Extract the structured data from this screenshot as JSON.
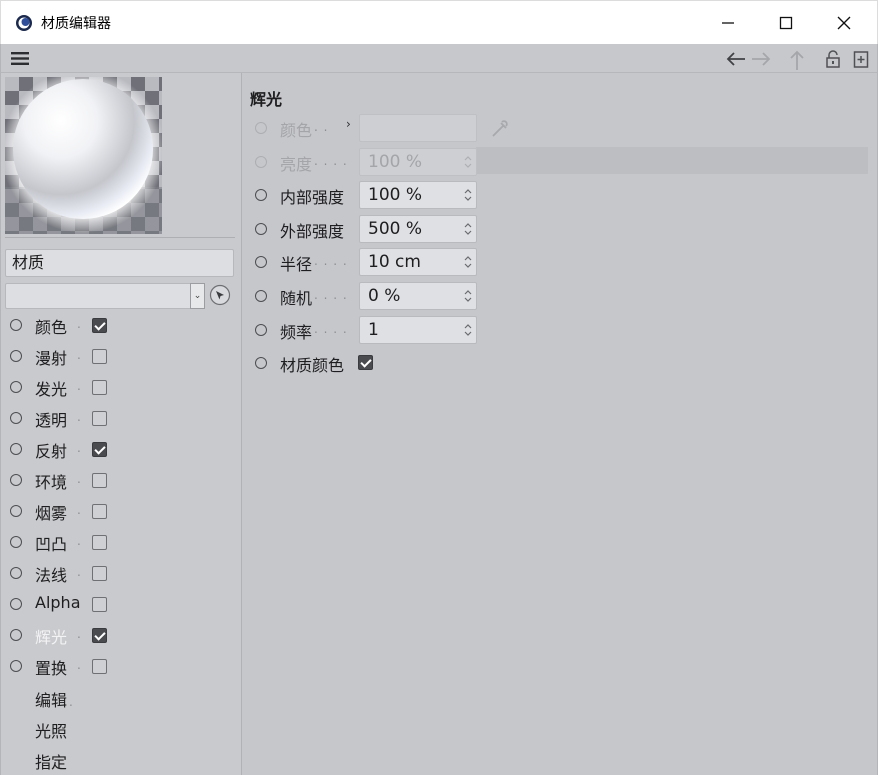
{
  "window": {
    "title": "材质编辑器",
    "app_icon": "cinema4d-logo-icon",
    "controls": [
      "minimize-icon",
      "maximize-icon",
      "close-icon"
    ]
  },
  "toolbar": {
    "menu_icon": "hamburger-menu-icon",
    "nav_icons": [
      "arrow-left-icon",
      "arrow-right-icon",
      "arrow-up-icon",
      "lock-icon",
      "new-window-icon"
    ]
  },
  "left_panel": {
    "material_name": "材质",
    "channels": [
      {
        "label": "颜色",
        "dots": ".",
        "checked": true
      },
      {
        "label": "漫射",
        "dots": ".",
        "checked": false
      },
      {
        "label": "发光",
        "dots": ".",
        "checked": false
      },
      {
        "label": "透明",
        "dots": ".",
        "checked": false
      },
      {
        "label": "反射",
        "dots": ".",
        "checked": true
      },
      {
        "label": "环境",
        "dots": ".",
        "checked": false
      },
      {
        "label": "烟雾",
        "dots": ".",
        "checked": false
      },
      {
        "label": "凹凸",
        "dots": ".",
        "checked": false
      },
      {
        "label": "法线",
        "dots": ".",
        "checked": false
      },
      {
        "label": "Alpha",
        "dots": "",
        "checked": false
      },
      {
        "label": "辉光",
        "dots": ".",
        "checked": true
      },
      {
        "label": "置换",
        "dots": ".",
        "checked": false
      }
    ],
    "extra_items": [
      {
        "label": "编辑",
        "dots": "."
      },
      {
        "label": "光照",
        "dots": ""
      },
      {
        "label": "指定",
        "dots": ""
      }
    ]
  },
  "right_panel": {
    "section_title": "辉光",
    "params": [
      {
        "label": "颜色",
        "dots": ". .",
        "value": "",
        "disabled": true
      },
      {
        "label": "亮度",
        "dots": ". . . .",
        "value": "100 %",
        "disabled": true
      },
      {
        "label": "内部强度",
        "dots": "",
        "value": "100 %",
        "disabled": false
      },
      {
        "label": "外部强度",
        "dots": "",
        "value": "500 %",
        "disabled": false
      },
      {
        "label": "半径",
        "dots": ". . . .",
        "value": "10 cm",
        "disabled": false
      },
      {
        "label": "随机",
        "dots": ". . . .",
        "value": "0 %",
        "disabled": false
      },
      {
        "label": "频率",
        "dots": ". . . .",
        "value": "1",
        "disabled": false
      }
    ],
    "material_color": {
      "label": "材质颜色",
      "checked": true
    }
  },
  "colors": {
    "panel_bg": "#c6c7cb",
    "active_channel_text": "#f3f3f5"
  }
}
